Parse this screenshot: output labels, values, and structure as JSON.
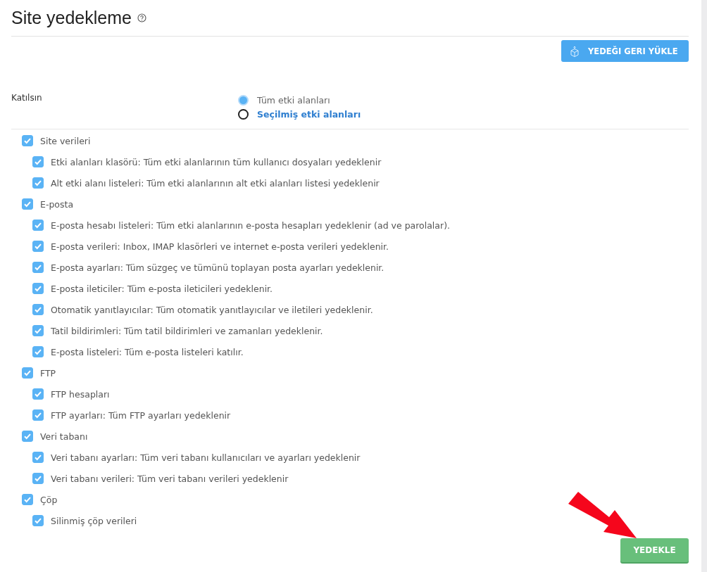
{
  "title": "Site yedekleme",
  "restore_button": "YEDEĞI GERI YÜKLE",
  "include": {
    "label": "Katılsın",
    "options": [
      {
        "label": "Tüm etki alanları",
        "selected": true
      },
      {
        "label": "Seçilmiş etki alanları",
        "selected": false
      }
    ]
  },
  "groups": [
    {
      "label": "Site verileri",
      "checked": true,
      "children": [
        {
          "label": "Etki alanları klasörü: Tüm etki alanlarının tüm kullanıcı dosyaları yedeklenir",
          "checked": true
        },
        {
          "label": "Alt etki alanı listeleri: Tüm etki alanlarının alt etki alanları listesi yedeklenir",
          "checked": true
        }
      ]
    },
    {
      "label": "E-posta",
      "checked": true,
      "children": [
        {
          "label": "E-posta hesabı listeleri: Tüm etki alanlarının e-posta hesapları yedeklenir (ad ve parolalar).",
          "checked": true
        },
        {
          "label": "E-posta verileri: Inbox, IMAP klasörleri ve internet e-posta verileri yedeklenir.",
          "checked": true
        },
        {
          "label": "E-posta ayarları: Tüm süzgeç ve tümünü toplayan posta ayarları yedeklenir.",
          "checked": true
        },
        {
          "label": "E-posta ileticiler: Tüm e-posta ileticileri yedeklenir.",
          "checked": true
        },
        {
          "label": "Otomatik yanıtlayıcılar: Tüm otomatik yanıtlayıcılar ve iletileri yedeklenir.",
          "checked": true
        },
        {
          "label": "Tatil bildirimleri: Tüm tatil bildirimleri ve zamanları yedeklenir.",
          "checked": true
        },
        {
          "label": "E-posta listeleri: Tüm e-posta listeleri katılır.",
          "checked": true
        }
      ]
    },
    {
      "label": "FTP",
      "checked": true,
      "children": [
        {
          "label": "FTP hesapları",
          "checked": true
        },
        {
          "label": "FTP ayarları: Tüm FTP ayarları yedeklenir",
          "checked": true
        }
      ]
    },
    {
      "label": "Veri tabanı",
      "checked": true,
      "children": [
        {
          "label": "Veri tabanı ayarları: Tüm veri tabanı kullanıcıları ve ayarları yedeklenir",
          "checked": true
        },
        {
          "label": "Veri tabanı verileri: Tüm veri tabanı verileri yedeklenir",
          "checked": true
        }
      ]
    },
    {
      "label": "Çöp",
      "checked": true,
      "children": [
        {
          "label": "Silinmiş çöp verileri",
          "checked": true
        }
      ]
    }
  ],
  "backup_button": "YEDEKLE"
}
